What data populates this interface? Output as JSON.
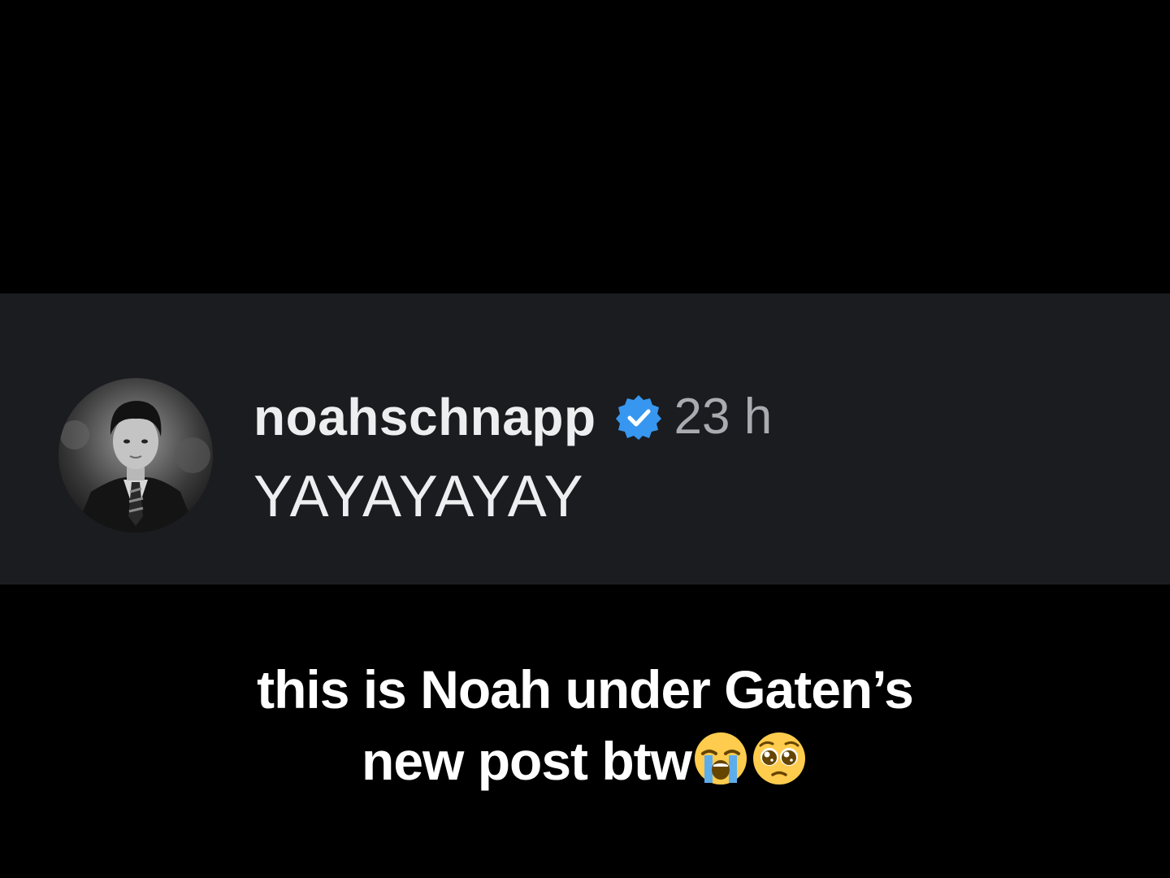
{
  "comment": {
    "username": "noahschnapp",
    "verified_icon": "verified-badge-icon",
    "timestamp": "23 h",
    "text": "YAYAYAYAY",
    "avatar_icon": "profile-photo"
  },
  "caption": {
    "line1": "this is Noah under Gaten’s",
    "line2": "new post btw",
    "emojis": [
      "loudly-crying-face-icon",
      "pleading-face-icon"
    ]
  },
  "colors": {
    "background": "#000000",
    "card": "#1b1c1f",
    "username": "#eceef0",
    "timestamp": "#a8abb0",
    "verified": "#3797f0",
    "caption": "#ffffff"
  }
}
